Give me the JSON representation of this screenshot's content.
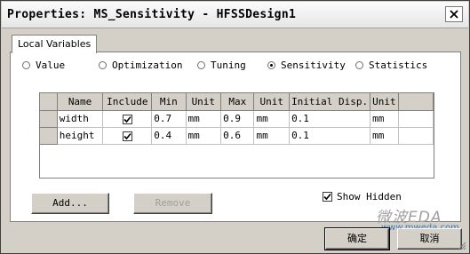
{
  "window": {
    "title": "Properties: MS_Sensitivity - HFSSDesign1"
  },
  "tabs": [
    {
      "label": "Local Variables",
      "selected": true
    }
  ],
  "radio_options": [
    {
      "label": "Value",
      "checked": false
    },
    {
      "label": "Optimization",
      "checked": false
    },
    {
      "label": "Tuning",
      "checked": false
    },
    {
      "label": "Sensitivity",
      "checked": true
    },
    {
      "label": "Statistics",
      "checked": false
    }
  ],
  "table": {
    "columns": [
      "Name",
      "Include",
      "Min",
      "Unit",
      "Max",
      "Unit",
      "Initial Disp.",
      "Unit"
    ],
    "rows": [
      {
        "name": "width",
        "include": true,
        "min": "0.7",
        "min_unit": "mm",
        "max": "0.9",
        "max_unit": "mm",
        "initial": "0.1",
        "initial_unit": "mm"
      },
      {
        "name": "height",
        "include": true,
        "min": "0.4",
        "min_unit": "mm",
        "max": "0.6",
        "max_unit": "mm",
        "initial": "0.1",
        "initial_unit": "mm"
      }
    ]
  },
  "buttons": {
    "add": "Add...",
    "remove": "Remove",
    "ok": "确定",
    "cancel": "取消"
  },
  "show_hidden": {
    "label": "Show Hidden",
    "checked": true
  },
  "watermark": {
    "main": "微波EDA",
    "url": "www.mweda.com"
  },
  "colors": {
    "accent": "#d4d0c8",
    "watermark_url": "#3a7bb8"
  }
}
